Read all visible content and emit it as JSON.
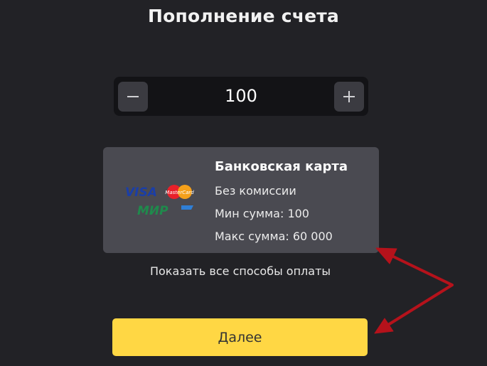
{
  "page": {
    "title": "Пополнение счета"
  },
  "amount_stepper": {
    "value": "100",
    "minus_icon": "minus-icon",
    "plus_icon": "plus-icon"
  },
  "payment_method": {
    "title": "Банковская карта",
    "commission": "Без комиссии",
    "min_amount": "Мин сумма: 100",
    "max_amount": "Макс сумма: 60 000",
    "logos": {
      "visa": "VISA",
      "mastercard": "MasterCard",
      "mir": "МИР"
    }
  },
  "show_all_methods": "Показать все способы оплаты",
  "next_button": "Далее",
  "colors": {
    "background": "#222226",
    "stepper_bg": "#131316",
    "card_bg": "#4a4a51",
    "primary_button": "#ffd744",
    "annotation_arrow": "#b5121b"
  }
}
